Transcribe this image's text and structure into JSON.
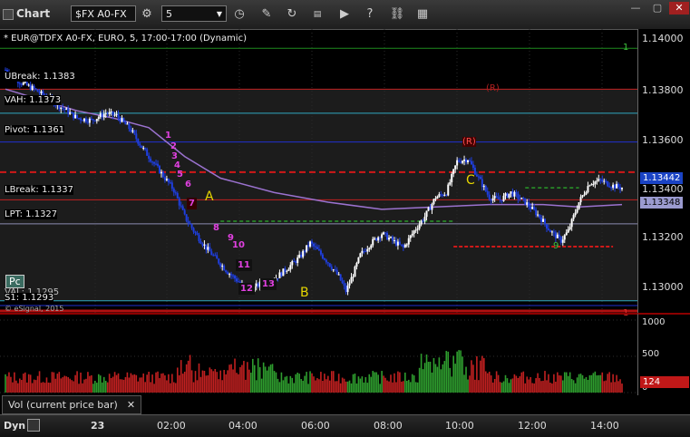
{
  "app": {
    "title": "Chart"
  },
  "toolbar": {
    "symbol": "$FX A0-FX",
    "interval": "5"
  },
  "chart_header": "* EUR@TDFX A0-FX, EURO, 5, 17:00-17:00 (Dynamic)",
  "copyright": "© eSignal, 2015",
  "price_axis": {
    "ticks": [
      "1.14000",
      "1.13800",
      "1.13600",
      "1.13400",
      "1.13200",
      "1.13000"
    ],
    "last_price": "1.13442",
    "other_price": "1.13348"
  },
  "level_labels": {
    "ubreak": "UBreak: 1.1383",
    "vah": "VAH: 1.1373",
    "pivot": "Pivot: 1.1361",
    "lbreak": "LBreak: 1.1337",
    "lpt": "LPT: 1.1327",
    "val": "VAL: 1.1295",
    "s1": "S1: 1.1293"
  },
  "markers": {
    "pc": "Pc",
    "r_top": "(R)",
    "r_mid": "(R)",
    "a": "A",
    "b": "B",
    "c": "C",
    "seq": [
      "1",
      "2",
      "3",
      "4",
      "5",
      "6",
      "7",
      "8",
      "9",
      "10",
      "11",
      "12",
      "13"
    ],
    "nine_right": "9",
    "one_top": "1",
    "one_bottom": "1"
  },
  "volume": {
    "legend": "Vol (current price bar)",
    "ticks": [
      "1000",
      "500",
      "0"
    ],
    "last": "124"
  },
  "time_axis": {
    "mode": "Dyn",
    "labels": [
      "23",
      "02:00",
      "04:00",
      "06:00",
      "08:00",
      "10:00",
      "12:00",
      "14:00"
    ]
  },
  "colors": {
    "up": "#ffffff",
    "down": "#1f3fe0",
    "volume_up": "#2e9c2e",
    "volume_down": "#c02020",
    "ma": "#9b72cf",
    "last_badge": "#1a43c4",
    "volume_badge": "#c01818"
  },
  "chart_data": {
    "type": "candlestick",
    "title": "* EUR@TDFX A0-FX, EURO, 5, 17:00-17:00 (Dynamic)",
    "ylim": [
      1.129,
      1.1408
    ],
    "yticks": [
      1.14,
      1.138,
      1.136,
      1.134,
      1.132,
      1.13
    ],
    "x_labels": [
      "23",
      "02:00",
      "04:00",
      "06:00",
      "08:00",
      "10:00",
      "12:00",
      "14:00"
    ],
    "levels": [
      {
        "name": "UBreak",
        "value": 1.1383
      },
      {
        "name": "VAH",
        "value": 1.1373
      },
      {
        "name": "Pivot",
        "value": 1.1361
      },
      {
        "name": "LBreak",
        "value": 1.1337
      },
      {
        "name": "LPT",
        "value": 1.1327
      },
      {
        "name": "VAL",
        "value": 1.1295
      },
      {
        "name": "S1",
        "value": 1.1293
      }
    ],
    "close_path": [
      [
        0,
        1.1391
      ],
      [
        8,
        1.1386
      ],
      [
        16,
        1.1383
      ],
      [
        24,
        1.1379
      ],
      [
        32,
        1.1375
      ],
      [
        40,
        1.1371
      ],
      [
        48,
        1.137
      ],
      [
        56,
        1.1373
      ],
      [
        62,
        1.1372
      ],
      [
        70,
        1.1366
      ],
      [
        76,
        1.1359
      ],
      [
        82,
        1.1353
      ],
      [
        88,
        1.1347
      ],
      [
        94,
        1.1341
      ],
      [
        100,
        1.133
      ],
      [
        106,
        1.1323
      ],
      [
        112,
        1.1317
      ],
      [
        118,
        1.1312
      ],
      [
        124,
        1.1307
      ],
      [
        130,
        1.1303
      ],
      [
        136,
        1.1299
      ],
      [
        142,
        1.1302
      ],
      [
        150,
        1.1304
      ],
      [
        158,
        1.1309
      ],
      [
        164,
        1.1313
      ],
      [
        170,
        1.1319
      ],
      [
        174,
        1.1316
      ],
      [
        180,
        1.1311
      ],
      [
        186,
        1.1305
      ],
      [
        190,
        1.1299
      ],
      [
        194,
        1.1306
      ],
      [
        198,
        1.1314
      ],
      [
        204,
        1.1319
      ],
      [
        210,
        1.1323
      ],
      [
        216,
        1.132
      ],
      [
        222,
        1.1317
      ],
      [
        228,
        1.1324
      ],
      [
        234,
        1.133
      ],
      [
        240,
        1.1338
      ],
      [
        246,
        1.134
      ],
      [
        252,
        1.1353
      ],
      [
        258,
        1.1354
      ],
      [
        264,
        1.1346
      ],
      [
        270,
        1.1338
      ],
      [
        276,
        1.1337
      ],
      [
        282,
        1.134
      ],
      [
        290,
        1.1336
      ],
      [
        298,
        1.133
      ],
      [
        304,
        1.1324
      ],
      [
        310,
        1.132
      ],
      [
        314,
        1.1324
      ],
      [
        320,
        1.1336
      ],
      [
        326,
        1.1344
      ],
      [
        332,
        1.1345
      ],
      [
        338,
        1.1343
      ],
      [
        344,
        1.1342
      ]
    ],
    "moving_average": [
      [
        0,
        1.1383
      ],
      [
        40,
        1.1374
      ],
      [
        60,
        1.1371
      ],
      [
        80,
        1.1367
      ],
      [
        100,
        1.1355
      ],
      [
        120,
        1.1346
      ],
      [
        150,
        1.134
      ],
      [
        180,
        1.1336
      ],
      [
        210,
        1.1333
      ],
      [
        240,
        1.1334
      ],
      [
        270,
        1.1335
      ],
      [
        300,
        1.1335
      ],
      [
        320,
        1.1334
      ],
      [
        344,
        1.1335
      ]
    ],
    "volume": {
      "ylim": [
        0,
        1000
      ],
      "yticks": [
        1000,
        500,
        0
      ],
      "last": 124
    }
  }
}
